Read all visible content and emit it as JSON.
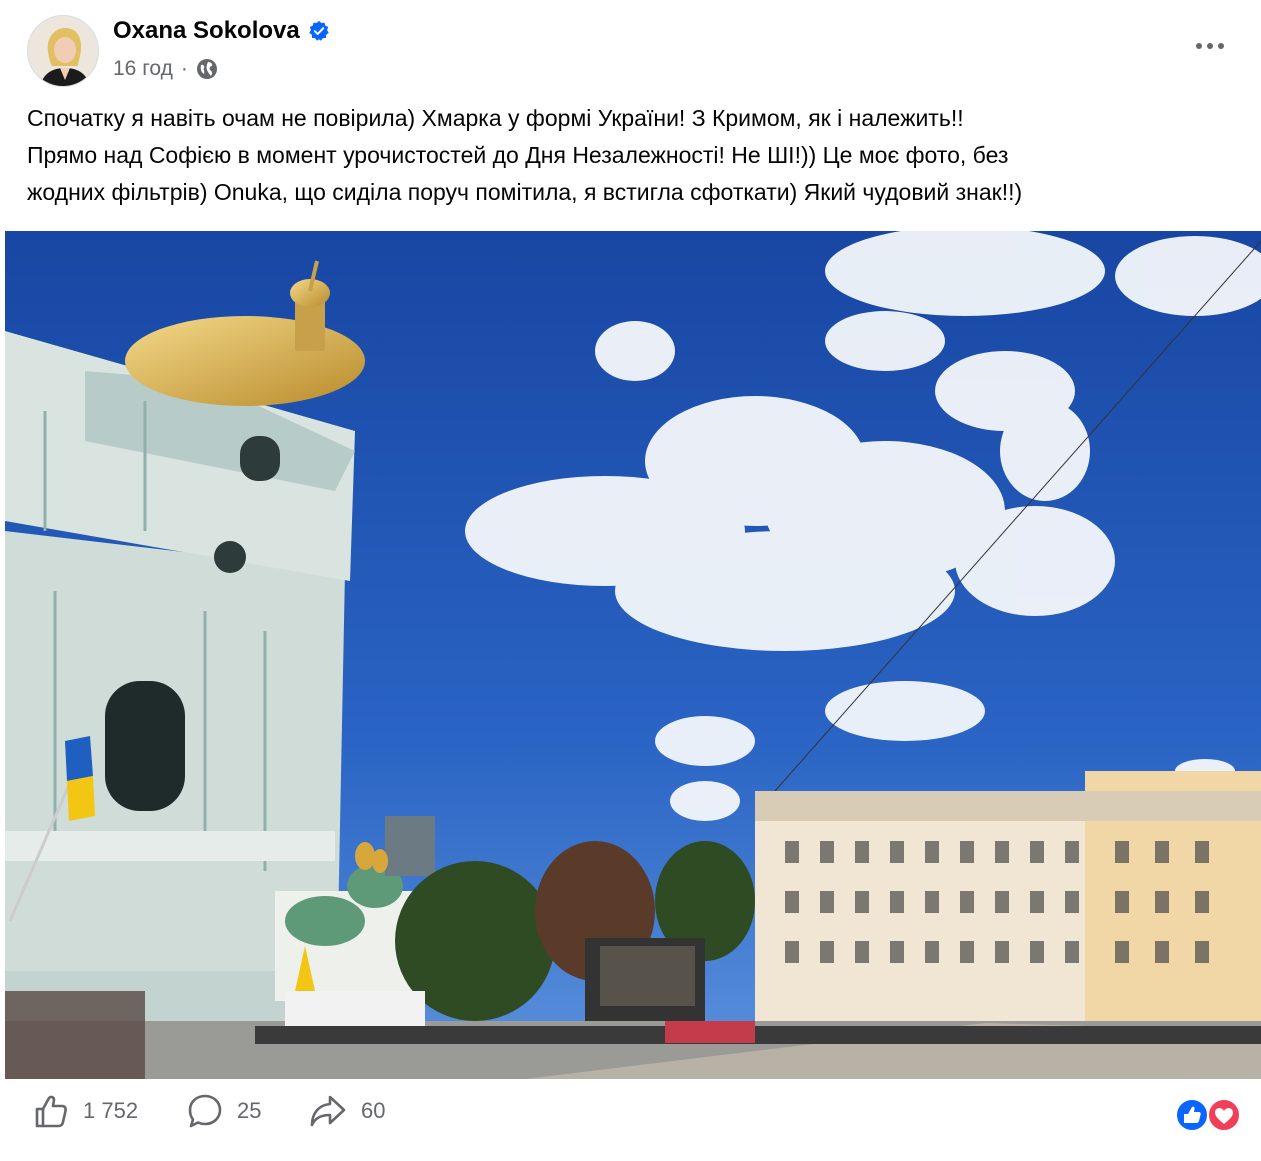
{
  "author": {
    "name": "Oxana Sokolova",
    "verified_icon": "verified-badge-icon"
  },
  "meta": {
    "time": "16 год",
    "separator": "·",
    "privacy_icon": "globe-icon"
  },
  "post": {
    "lines": [
      "Спочатку я навіть очам не повірила) Хмарка у формі України! З Кримом, як і належить!!",
      "Прямо над Софією в момент урочистостей до Дня Незалежності! Не ШІ!)) Це моє фото, без",
      "жодних фільтрів) Onuka, що сиділа поруч помітила, я встигла сфоткати) Який чудовий знак!!)"
    ]
  },
  "actions": {
    "like_count": "1 752",
    "comment_count": "25",
    "share_count": "60"
  },
  "colors": {
    "accent": "#0866ff",
    "love": "#f33e58",
    "secondary_text": "#65676b",
    "sky": "#1f4fa8"
  }
}
